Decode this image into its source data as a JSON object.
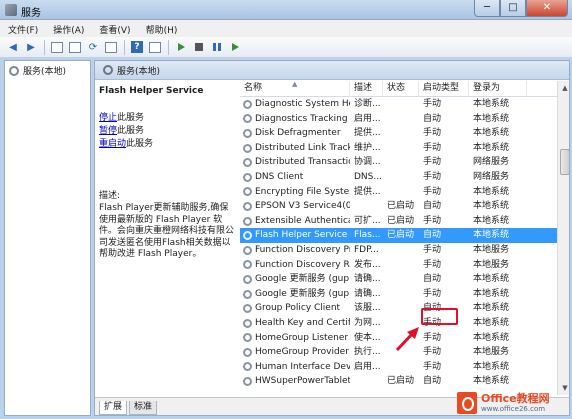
{
  "window": {
    "title": "服务",
    "buttons": {
      "minimize": "─",
      "maximize": "□",
      "close": "✕"
    }
  },
  "menu": [
    "文件(F)",
    "操作(A)",
    "查看(V)",
    "帮助(H)"
  ],
  "tree": {
    "root": "服务(本地)"
  },
  "pane": {
    "title": "服务(本地)"
  },
  "details": {
    "service_name": "Flash Helper Service",
    "actions": [
      {
        "link": "停止",
        "suffix": "此服务"
      },
      {
        "link": "暂停",
        "suffix": "此服务"
      },
      {
        "link": "重启动",
        "suffix": "此服务"
      }
    ],
    "description_label": "描述:",
    "description": "Flash Player更新辅助服务,确保使用最新版的 Flash Player 软件。会向重庆重橙网络科技有限公司发送匿名使用Flash相关数据以帮助改进 Flash Player。"
  },
  "columns": [
    "名称",
    "描述",
    "状态",
    "启动类型",
    "登录为"
  ],
  "services": [
    [
      "Diagnostic System Host",
      "诊断...",
      "",
      "手动",
      "本地系统"
    ],
    [
      "Diagnostics Tracking ...",
      "启用...",
      "",
      "自动",
      "本地系统"
    ],
    [
      "Disk Defragmenter",
      "提供...",
      "",
      "手动",
      "本地系统"
    ],
    [
      "Distributed Link Track...",
      "维护...",
      "",
      "手动",
      "本地系统"
    ],
    [
      "Distributed Transaction...",
      "协调...",
      "",
      "手动",
      "网络服务"
    ],
    [
      "DNS Client",
      "DNS...",
      "",
      "手动",
      "网络服务"
    ],
    [
      "Encrypting File System ...",
      "提供...",
      "",
      "手动",
      "本地系统"
    ],
    [
      "EPSON V3 Service4(05)",
      "",
      "已启动",
      "自动",
      "本地系统"
    ],
    [
      "Extensible Authenticat...",
      "可扩...",
      "已启动",
      "手动",
      "本地系统"
    ],
    [
      "Flash Helper Service",
      "Flas...",
      "已启动",
      "自动",
      "本地系统"
    ],
    [
      "Function Discovery Pr...",
      "FDP...",
      "",
      "手动",
      "本地服务"
    ],
    [
      "Function Discovery Re...",
      "发布...",
      "",
      "手动",
      "本地服务"
    ],
    [
      "Google 更新服务 (gup...",
      "请确...",
      "",
      "自动",
      "本地系统"
    ],
    [
      "Google 更新服务 (gup...",
      "请确...",
      "",
      "手动",
      "本地系统"
    ],
    [
      "Group Policy Client",
      "该服...",
      "",
      "自动",
      "本地系统"
    ],
    [
      "Health Key and Certifi...",
      "为网...",
      "",
      "手动",
      "本地系统"
    ],
    [
      "HomeGroup Listener",
      "使本...",
      "",
      "手动",
      "本地系统"
    ],
    [
      "HomeGroup Provider",
      "执行...",
      "",
      "手动",
      "本地服务"
    ],
    [
      "Human Interface Devi...",
      "启用...",
      "",
      "手动",
      "本地系统"
    ],
    [
      "HWSuperPowerTablet",
      "",
      "已启动",
      "自动",
      "本地系统"
    ]
  ],
  "tabs": [
    "扩展",
    "标准"
  ],
  "watermark": {
    "brand": "Office教程网",
    "url": "www.office26.com"
  }
}
